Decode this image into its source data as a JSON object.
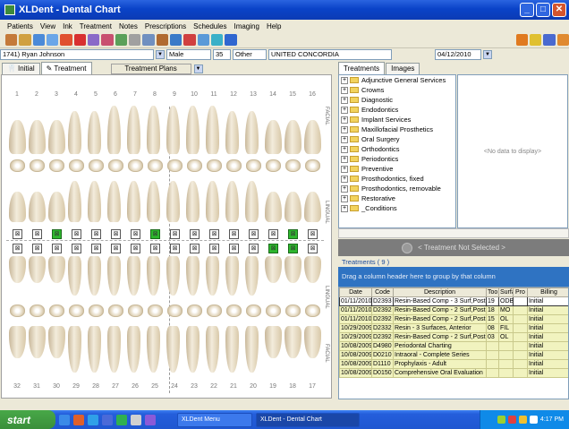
{
  "window": {
    "title": "XLDent - Dental Chart",
    "icon": "xldent-app-icon"
  },
  "menu": [
    "Patients",
    "View",
    "Ink",
    "Treatment",
    "Notes",
    "Prescriptions",
    "Schedules",
    "Imaging",
    "Help"
  ],
  "patient": {
    "name": "1741) Ryan Johnson",
    "gender": "Male",
    "age": "35",
    "relation": "Other",
    "insurance": "UNITED CONCORDIA",
    "date": "04/12/2010"
  },
  "left_tabs": {
    "initial": "Initial",
    "treatment": "Treatment",
    "plans": "Treatment Plans"
  },
  "chart": {
    "upper_numbers": [
      "1",
      "2",
      "3",
      "4",
      "5",
      "6",
      "7",
      "8",
      "9",
      "10",
      "11",
      "12",
      "13",
      "14",
      "15",
      "16"
    ],
    "lower_numbers": [
      "32",
      "31",
      "30",
      "29",
      "28",
      "27",
      "26",
      "25",
      "24",
      "23",
      "22",
      "21",
      "20",
      "19",
      "18",
      "17"
    ],
    "facial": "FACIAL",
    "lingual": "LINGUAL"
  },
  "right_tabs": {
    "treatments": "Treatments",
    "images": "Images"
  },
  "tree": [
    "Adjunctive General Services",
    "Crowns",
    "Diagnostic",
    "Endodontics",
    "Implant Services",
    "Maxillofacial Prosthetics",
    "Oral Surgery",
    "Orthodontics",
    "Periodontics",
    "Preventive",
    "Prosthodontics, fixed",
    "Prosthodontics, removable",
    "Restorative",
    "_Conditions"
  ],
  "no_data": "<No data to display>",
  "treatment_not_selected": "< Treatment Not Selected >",
  "treatments_count": "Treatments ( 9 )",
  "group_hint": "Drag a column header here to group by that column",
  "grid": {
    "columns": [
      "Date",
      "Code",
      "Description",
      "Too",
      "Surfa",
      "Pro",
      "Billing"
    ],
    "rows": [
      [
        "01/11/2010",
        "D2393",
        "Resin-Based Comp - 3 Surf,Post",
        "19",
        "ODB",
        "",
        "Initial"
      ],
      [
        "01/11/2010",
        "D2392",
        "Resin-Based Comp - 2 Surf,Post",
        "18",
        "MO",
        "",
        "Initial"
      ],
      [
        "01/11/2010",
        "D2392",
        "Resin-Based Comp - 2 Surf,Post",
        "15",
        "OL",
        "",
        "Initial"
      ],
      [
        "10/29/2009",
        "D2332",
        "Resin - 3 Surfaces, Anterior",
        "08",
        "FIL",
        "",
        "Initial"
      ],
      [
        "10/29/2009",
        "D2392",
        "Resin-Based Comp - 2 Surf,Post",
        "03",
        "OL",
        "",
        "Initial"
      ],
      [
        "10/08/2009",
        "D4980",
        "Periodontal Charting",
        "",
        "",
        "",
        "Initial"
      ],
      [
        "10/08/2009",
        "D0210",
        "Intraoral - Complete Series",
        "",
        "",
        "",
        "Initial"
      ],
      [
        "10/08/2009",
        "D1110",
        "Prophylaxis - Adult",
        "",
        "",
        "",
        "Initial"
      ],
      [
        "10/08/2009",
        "D0150",
        "Comprehensive Oral Evaluation",
        "",
        "",
        "",
        "Initial"
      ]
    ]
  },
  "taskbar": {
    "start": "start",
    "tasks": [
      "XLDent Menu",
      "XLDent - Dental Chart"
    ],
    "clock": "4:17 PM"
  }
}
